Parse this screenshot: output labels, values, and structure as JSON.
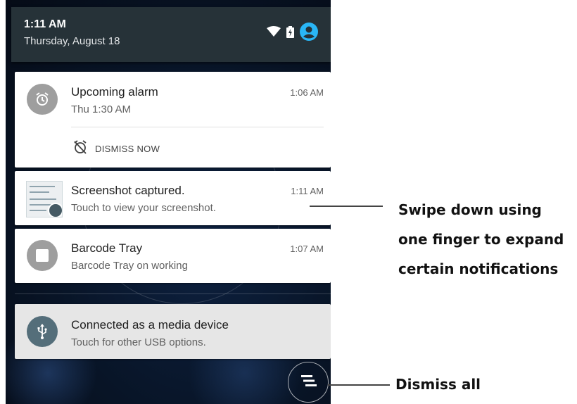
{
  "status": {
    "time": "1:11 AM",
    "date": "Thursday, August 18",
    "icons": [
      "wifi-icon",
      "battery-icon",
      "user-icon"
    ],
    "accent_color": "#29b6f6"
  },
  "notifications": [
    {
      "id": "alarm",
      "icon": "alarm-clock-icon",
      "title": "Upcoming alarm",
      "subtitle": "Thu 1:30 AM",
      "time": "1:06 AM",
      "action": {
        "icon": "alarm-off-icon",
        "label": "DISMISS NOW"
      }
    },
    {
      "id": "screenshot",
      "icon": "screenshot-thumbnail",
      "title": "Screenshot captured.",
      "subtitle": "Touch to view your screenshot.",
      "time": "1:11 AM"
    },
    {
      "id": "barcode",
      "icon": "stop-square-icon",
      "title": "Barcode Tray",
      "subtitle": "Barcode Tray on working",
      "time": "1:07 AM"
    },
    {
      "id": "usb",
      "icon": "usb-icon",
      "title": "Connected as a media device",
      "subtitle": "Touch for other USB options."
    }
  ],
  "dismiss_all": {
    "icon": "clear-all-icon"
  },
  "callouts": {
    "swipe_lines": [
      "Swipe down using",
      "one finger to expand",
      "certain notifications"
    ],
    "dismiss": "Dismiss all"
  }
}
